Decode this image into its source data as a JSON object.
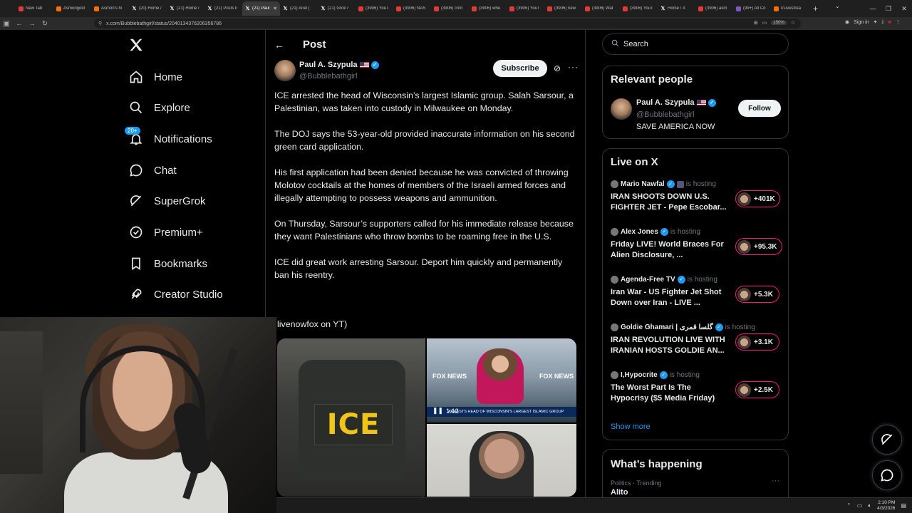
{
  "browser": {
    "tabs": [
      {
        "label": "New Tab",
        "fav": "red"
      },
      {
        "label": "Asmongold",
        "fav": "orange"
      },
      {
        "label": "Asmon's hi",
        "fav": "orange"
      },
      {
        "label": "(20) Home /",
        "fav": "x"
      },
      {
        "label": "(21) Home /",
        "fav": "x"
      },
      {
        "label": "(21) Posts li",
        "fav": "x"
      },
      {
        "label": "(21) Paul",
        "fav": "x",
        "active": true
      },
      {
        "label": "(21) Ariel (",
        "fav": "x"
      },
      {
        "label": "(21) Grok /",
        "fav": "x"
      },
      {
        "label": "(3906) YouT",
        "fav": "red"
      },
      {
        "label": "(3906) NAS",
        "fav": "red"
      },
      {
        "label": "(3906) crim",
        "fav": "red"
      },
      {
        "label": "(3906) whe",
        "fav": "red"
      },
      {
        "label": "(3906) YouT",
        "fav": "red"
      },
      {
        "label": "(3906) new",
        "fav": "red"
      },
      {
        "label": "(3906) Wat",
        "fav": "red"
      },
      {
        "label": "(3906) YouT",
        "fav": "red"
      },
      {
        "label": "Home / X",
        "fav": "x"
      },
      {
        "label": "(3906) asm",
        "fav": "red"
      },
      {
        "label": "(99+) All Co",
        "fav": "purple"
      },
      {
        "label": "r/Livestrea",
        "fav": "orange"
      }
    ],
    "url": "x.com/Bubblebathgirl/status/2040134376206356786",
    "zoom": "150%",
    "signin": "Sign in"
  },
  "nav": {
    "logo": "X",
    "items": [
      {
        "label": "Home",
        "icon": "home-icon"
      },
      {
        "label": "Explore",
        "icon": "search-icon"
      },
      {
        "label": "Notifications",
        "icon": "bell-icon",
        "badge": "20+"
      },
      {
        "label": "Chat",
        "icon": "chat-icon"
      },
      {
        "label": "SuperGrok",
        "icon": "grok-icon"
      },
      {
        "label": "Premium+",
        "icon": "premium-icon"
      },
      {
        "label": "Bookmarks",
        "icon": "bookmark-icon"
      },
      {
        "label": "Creator Studio",
        "icon": "rocket-icon"
      }
    ]
  },
  "post": {
    "header_title": "Post",
    "author_name": "Paul A. Szypula",
    "author_handle": "@Bubblebathgirl",
    "subscribe_label": "Subscribe",
    "paragraphs": [
      "ICE arrested the head of Wisconsin’s largest Islamic group. Salah Sarsour, a Palestinian, was taken into custody in Milwaukee on Monday.",
      "The DOJ says the 53-year-old provided inaccurate information on his second green card application.",
      "His first application had been denied because he was convicted of throwing Molotov cocktails at the homes of members of the Israeli armed forces and illegally attempting to possess weapons and ammunition.",
      "On Thursday, Sarsour’s supporters called for his immediate release because they want Palestinians who throw bombs to be roaming free in the U.S.",
      "ICE did great work arresting Sarsour. Deport him quickly and permanently ban his reentry."
    ],
    "source_line": "livenowfox on YT)",
    "media": {
      "ice_text": "ICE",
      "fox_logo": "FOX NEWS",
      "video_time": "1:12",
      "chyron": "ARRESTS HEAD OF WISCONSIN'S LARGEST ISLAMIC GROUP"
    }
  },
  "sidebar": {
    "search_placeholder": "Search",
    "relevant_title": "Relevant people",
    "relevant_person": {
      "name": "Paul A. Szypula",
      "handle": "@Bubblebathgirl",
      "bio": "SAVE AMERICA NOW",
      "follow_label": "Follow"
    },
    "live_title": "Live on X",
    "hosting_label": "is hosting",
    "live_items": [
      {
        "host": "Mario Nawfal",
        "title": "IRAN SHOOTS DOWN U.S. FIGHTER JET - Pepe Escobar...",
        "count": "+401K"
      },
      {
        "host": "Alex Jones",
        "title": "Friday LIVE! World Braces For Alien Disclosure, ...",
        "count": "+95.3K"
      },
      {
        "host": "Agenda-Free TV",
        "title": "Iran War - US Fighter Jet Shot Down over Iran - LIVE ...",
        "count": "+5.3K"
      },
      {
        "host": "Goldie Ghamari | گلسا قمری",
        "title": "IRAN REVOLUTION LIVE WITH IRANIAN HOSTS GOLDIE AN...",
        "count": "+3.1K"
      },
      {
        "host": "I,Hypocrite",
        "title": "The Worst Part Is The Hypocrisy ($5 Media Friday)",
        "count": "+2.5K"
      }
    ],
    "show_more": "Show more",
    "happening_title": "What’s happening",
    "happening_meta": "Politics · Trending",
    "happening_topic": "Alito"
  },
  "taskbar": {
    "time": "2:10 PM",
    "date": "4/3/2026"
  }
}
